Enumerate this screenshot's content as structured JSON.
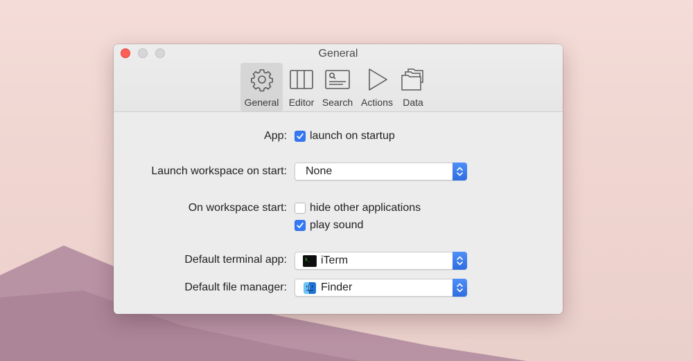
{
  "window": {
    "title": "General"
  },
  "toolbar": {
    "tabs": [
      {
        "label": "General",
        "icon": "gear-icon",
        "active": true
      },
      {
        "label": "Editor",
        "icon": "columns-icon",
        "active": false
      },
      {
        "label": "Search",
        "icon": "search-window-icon",
        "active": false
      },
      {
        "label": "Actions",
        "icon": "play-icon",
        "active": false
      },
      {
        "label": "Data",
        "icon": "folders-icon",
        "active": false
      }
    ]
  },
  "settings": {
    "app": {
      "label": "App:",
      "option": "launch on startup",
      "checked": true
    },
    "launch_workspace": {
      "label": "Launch workspace on start:",
      "value": "None"
    },
    "on_workspace_start": {
      "label": "On workspace start:",
      "options": [
        {
          "text": "hide other applications",
          "checked": false
        },
        {
          "text": "play sound",
          "checked": true
        }
      ]
    },
    "terminal": {
      "label": "Default terminal app:",
      "value": "iTerm",
      "icon": "terminal-icon"
    },
    "file_manager": {
      "label": "Default file manager:",
      "value": "Finder",
      "icon": "finder-icon"
    }
  },
  "colors": {
    "accent": "#3478f6",
    "close": "#fe5f57"
  }
}
